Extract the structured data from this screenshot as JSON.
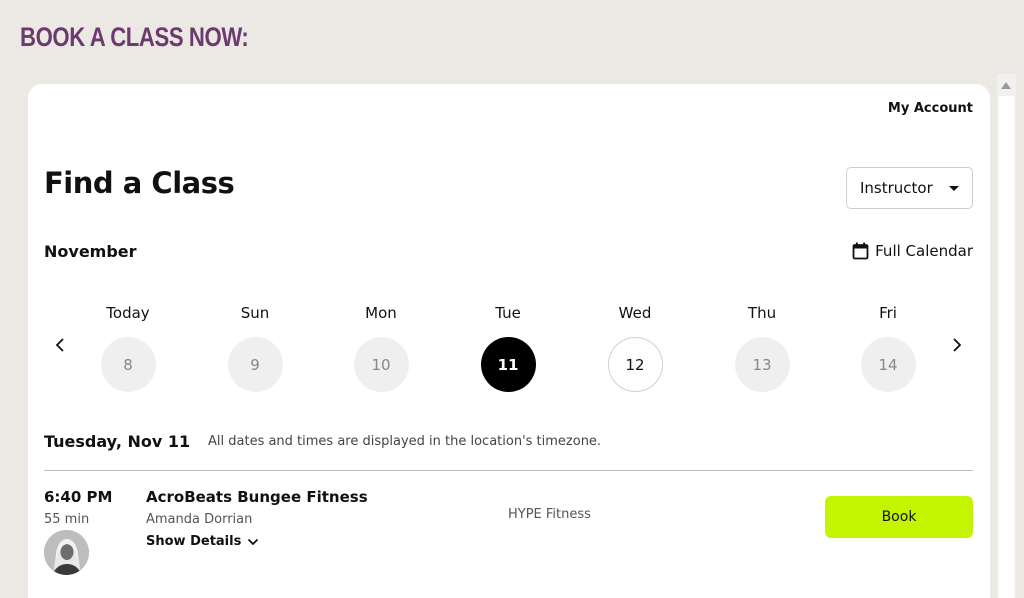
{
  "page": {
    "heading": "BOOK A CLASS NOW:"
  },
  "header": {
    "my_account": "My Account",
    "title": "Find a Class"
  },
  "filter": {
    "instructor_label": "Instructor"
  },
  "calendar": {
    "month": "November",
    "full_calendar_label": "Full Calendar",
    "days": [
      {
        "label": "Today",
        "date": "8",
        "state": "past"
      },
      {
        "label": "Sun",
        "date": "9",
        "state": "past"
      },
      {
        "label": "Mon",
        "date": "10",
        "state": "past"
      },
      {
        "label": "Tue",
        "date": "11",
        "state": "selected"
      },
      {
        "label": "Wed",
        "date": "12",
        "state": "available"
      },
      {
        "label": "Thu",
        "date": "13",
        "state": "past"
      },
      {
        "label": "Fri",
        "date": "14",
        "state": "past"
      }
    ]
  },
  "schedule": {
    "date_heading": "Tuesday, Nov 11",
    "timezone_note": "All dates and times are displayed in the location's timezone.",
    "classes": [
      {
        "time": "6:40 PM",
        "duration": "55 min",
        "name": "AcroBeats Bungee Fitness",
        "instructor": "Amanda Dorrian",
        "show_details": "Show Details",
        "location": "HYPE Fitness",
        "book_label": "Book"
      }
    ]
  },
  "colors": {
    "heading": "#6b3a6e",
    "book_button": "#c3f400",
    "selected_day": "#000000",
    "background": "#ece9e4"
  },
  "icons": [
    "calendar-icon",
    "chevron-left-icon",
    "chevron-right-icon",
    "chevron-down-icon",
    "caret-down-icon"
  ]
}
